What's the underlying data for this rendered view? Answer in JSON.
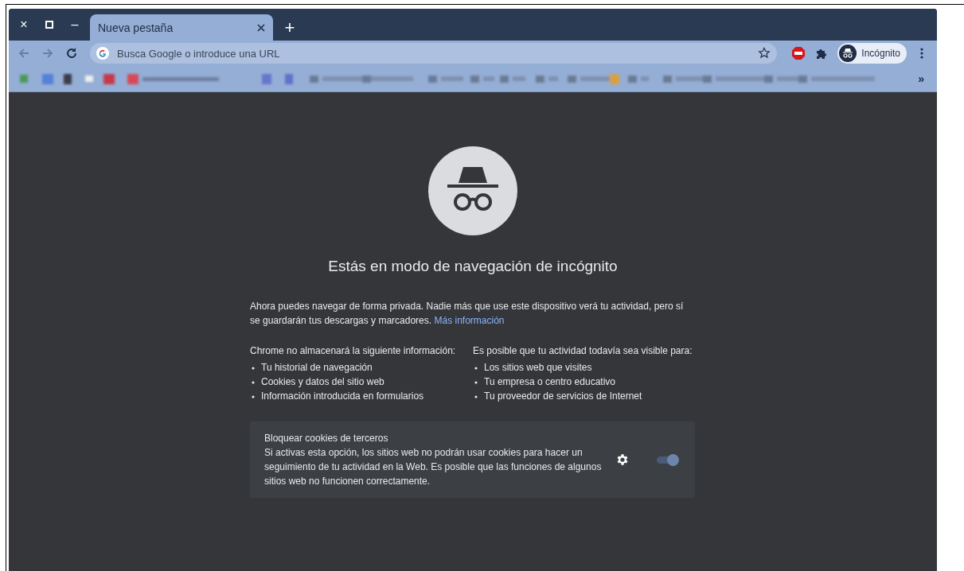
{
  "window_controls": [
    "×",
    "–"
  ],
  "tabs": [
    {
      "label": "Nueva pestaña",
      "selected": true
    }
  ],
  "new_tab": "+",
  "omnibox": {
    "placeholder": "Busca Google o introduce una URL"
  },
  "profile": {
    "label": "Incógnito"
  },
  "bookmarks_overflow": "»",
  "content": {
    "title": "Estás en modo de navegación de incógnito",
    "intro": "Ahora puedes navegar de forma privada. Nadie más que use este dispositivo verá tu actividad, pero sí se guardarán tus descargas y marcadores.",
    "intro_link": "Más información",
    "columns": [
      {
        "heading": "Chrome no almacenará la siguiente información:",
        "items": [
          "Tu historial de navegación",
          "Cookies y datos del sitio web",
          "Información introducida en formularios"
        ]
      },
      {
        "heading": "Es posible que tu actividad todavía sea visible para:",
        "items": [
          "Los sitios web que visites",
          "Tu empresa o centro educativo",
          "Tu proveedor de servicios de Internet"
        ]
      }
    ],
    "cookie_card": {
      "title": "Bloquear cookies de terceros",
      "text": "Si activas esta opción, los sitios web no podrán usar cookies para hacer un seguimiento de tu actividad en la Web. Es posible que las funciones de algunos sitios web no funcionen correctamente.",
      "on": true
    }
  }
}
